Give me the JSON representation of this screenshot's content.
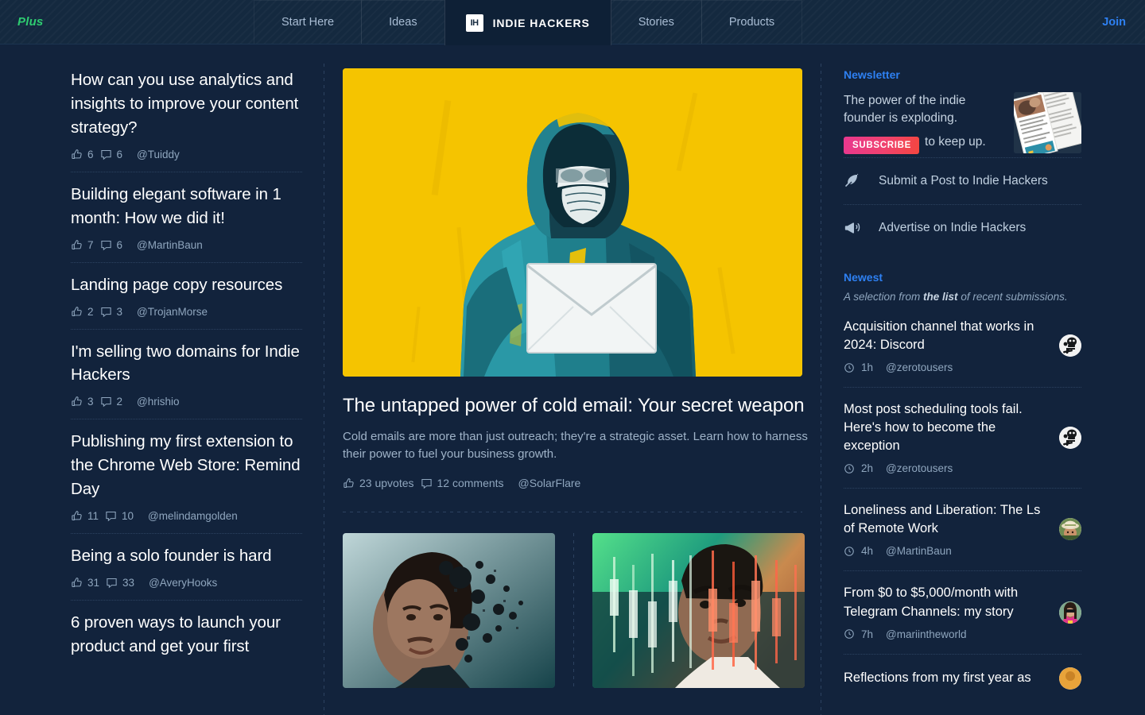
{
  "navbar": {
    "plus_label": "Plus",
    "join_label": "Join",
    "brand_mark": "IH",
    "tabs": [
      {
        "label": "Start Here",
        "active": false
      },
      {
        "label": "Ideas",
        "active": false
      },
      {
        "label": "INDIE HACKERS",
        "active": true
      },
      {
        "label": "Stories",
        "active": false
      },
      {
        "label": "Products",
        "active": false
      }
    ]
  },
  "left_posts": [
    {
      "title": "How can you use analytics and insights to improve your content strategy?",
      "upvotes": "6",
      "comments": "6",
      "user": "@Tuiddy"
    },
    {
      "title": "Building elegant software in 1 month: How we did it!",
      "upvotes": "7",
      "comments": "6",
      "user": "@MartinBaun"
    },
    {
      "title": "Landing page copy resources",
      "upvotes": "2",
      "comments": "3",
      "user": "@TrojanMorse"
    },
    {
      "title": "I'm selling two domains for Indie Hackers",
      "upvotes": "3",
      "comments": "2",
      "user": "@hrishio"
    },
    {
      "title": "Publishing my first extension to the Chrome Web Store: Remind Day",
      "upvotes": "11",
      "comments": "10",
      "user": "@melindamgolden"
    },
    {
      "title": "Being a solo founder is hard",
      "upvotes": "31",
      "comments": "33",
      "user": "@AveryHooks"
    },
    {
      "title": "6 proven ways to launch your product and get your first",
      "upvotes": "",
      "comments": "",
      "user": ""
    }
  ],
  "main": {
    "featured": {
      "title": "The untapped power of cold email: Your secret weapon",
      "description": "Cold emails are more than just outreach; they're a strategic asset. Learn how to harness their power to fuel your business growth.",
      "upvotes_label": "23 upvotes",
      "comments_label": "12 comments",
      "user": "@SolarFlare",
      "image_alt": "hooded-figure-holding-envelope-illustration"
    },
    "sub_cards": [
      {
        "image_alt": "man-portrait-dispersion-effect"
      },
      {
        "image_alt": "man-portrait-with-candlestick-chart-overlay"
      }
    ]
  },
  "right": {
    "newsletter": {
      "heading": "Newsletter",
      "text": "The power of the indie founder is exploding.",
      "subscribe_label": "SUBSCRIBE",
      "after_button_text": "to keep up.",
      "thumb_alt": "newsletter-pages-mockup"
    },
    "links": [
      {
        "label": "Submit a Post to Indie Hackers",
        "icon": "feather-icon"
      },
      {
        "label": "Advertise on Indie Hackers",
        "icon": "megaphone-icon"
      }
    ],
    "newest": {
      "heading": "Newest",
      "subtitle_pre": "A selection from ",
      "subtitle_link": "the list",
      "subtitle_post": " of recent submissions.",
      "items": [
        {
          "title": "Acquisition channel that works in 2024: Discord",
          "time": "1h",
          "user": "@zerotousers",
          "avatar": "skull-avatar"
        },
        {
          "title": "Most post scheduling tools fail. Here's how to become the exception",
          "time": "2h",
          "user": "@zerotousers",
          "avatar": "skull-avatar"
        },
        {
          "title": "Loneliness and Liberation: The Ls of Remote Work",
          "time": "4h",
          "user": "@MartinBaun",
          "avatar": "hat-person-avatar"
        },
        {
          "title": "From $0 to $5,000/month with Telegram Channels: my story",
          "time": "7h",
          "user": "@mariintheworld",
          "avatar": "sunglasses-person-avatar"
        },
        {
          "title": "Reflections from my first year as",
          "time": "",
          "user": "",
          "avatar": "orange-avatar"
        }
      ]
    }
  },
  "colors": {
    "page_bg": "#12233C",
    "nav_bg": "#14293F",
    "accent_blue": "#2E80F2",
    "plus_green": "#2ECC71",
    "hero_yellow": "#F5C400",
    "subscribe_gradient_start": "#E8388F",
    "subscribe_gradient_end": "#F4463F",
    "muted_text": "#8FA6BE"
  }
}
